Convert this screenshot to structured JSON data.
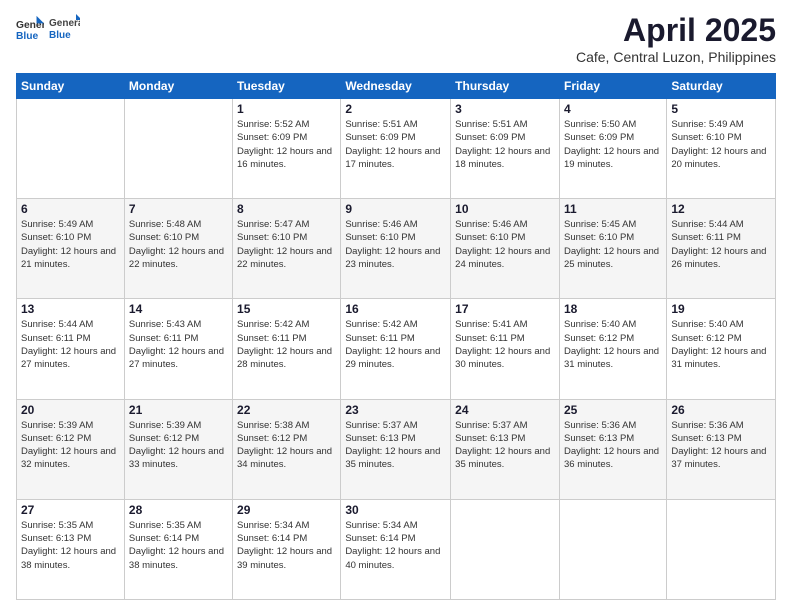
{
  "logo": {
    "general": "General",
    "blue": "Blue"
  },
  "header": {
    "month": "April 2025",
    "location": "Cafe, Central Luzon, Philippines"
  },
  "weekdays": [
    "Sunday",
    "Monday",
    "Tuesday",
    "Wednesday",
    "Thursday",
    "Friday",
    "Saturday"
  ],
  "weeks": [
    [
      {
        "day": null
      },
      {
        "day": null
      },
      {
        "day": "1",
        "sunrise": "Sunrise: 5:52 AM",
        "sunset": "Sunset: 6:09 PM",
        "daylight": "Daylight: 12 hours and 16 minutes."
      },
      {
        "day": "2",
        "sunrise": "Sunrise: 5:51 AM",
        "sunset": "Sunset: 6:09 PM",
        "daylight": "Daylight: 12 hours and 17 minutes."
      },
      {
        "day": "3",
        "sunrise": "Sunrise: 5:51 AM",
        "sunset": "Sunset: 6:09 PM",
        "daylight": "Daylight: 12 hours and 18 minutes."
      },
      {
        "day": "4",
        "sunrise": "Sunrise: 5:50 AM",
        "sunset": "Sunset: 6:09 PM",
        "daylight": "Daylight: 12 hours and 19 minutes."
      },
      {
        "day": "5",
        "sunrise": "Sunrise: 5:49 AM",
        "sunset": "Sunset: 6:10 PM",
        "daylight": "Daylight: 12 hours and 20 minutes."
      }
    ],
    [
      {
        "day": "6",
        "sunrise": "Sunrise: 5:49 AM",
        "sunset": "Sunset: 6:10 PM",
        "daylight": "Daylight: 12 hours and 21 minutes."
      },
      {
        "day": "7",
        "sunrise": "Sunrise: 5:48 AM",
        "sunset": "Sunset: 6:10 PM",
        "daylight": "Daylight: 12 hours and 22 minutes."
      },
      {
        "day": "8",
        "sunrise": "Sunrise: 5:47 AM",
        "sunset": "Sunset: 6:10 PM",
        "daylight": "Daylight: 12 hours and 22 minutes."
      },
      {
        "day": "9",
        "sunrise": "Sunrise: 5:46 AM",
        "sunset": "Sunset: 6:10 PM",
        "daylight": "Daylight: 12 hours and 23 minutes."
      },
      {
        "day": "10",
        "sunrise": "Sunrise: 5:46 AM",
        "sunset": "Sunset: 6:10 PM",
        "daylight": "Daylight: 12 hours and 24 minutes."
      },
      {
        "day": "11",
        "sunrise": "Sunrise: 5:45 AM",
        "sunset": "Sunset: 6:10 PM",
        "daylight": "Daylight: 12 hours and 25 minutes."
      },
      {
        "day": "12",
        "sunrise": "Sunrise: 5:44 AM",
        "sunset": "Sunset: 6:11 PM",
        "daylight": "Daylight: 12 hours and 26 minutes."
      }
    ],
    [
      {
        "day": "13",
        "sunrise": "Sunrise: 5:44 AM",
        "sunset": "Sunset: 6:11 PM",
        "daylight": "Daylight: 12 hours and 27 minutes."
      },
      {
        "day": "14",
        "sunrise": "Sunrise: 5:43 AM",
        "sunset": "Sunset: 6:11 PM",
        "daylight": "Daylight: 12 hours and 27 minutes."
      },
      {
        "day": "15",
        "sunrise": "Sunrise: 5:42 AM",
        "sunset": "Sunset: 6:11 PM",
        "daylight": "Daylight: 12 hours and 28 minutes."
      },
      {
        "day": "16",
        "sunrise": "Sunrise: 5:42 AM",
        "sunset": "Sunset: 6:11 PM",
        "daylight": "Daylight: 12 hours and 29 minutes."
      },
      {
        "day": "17",
        "sunrise": "Sunrise: 5:41 AM",
        "sunset": "Sunset: 6:11 PM",
        "daylight": "Daylight: 12 hours and 30 minutes."
      },
      {
        "day": "18",
        "sunrise": "Sunrise: 5:40 AM",
        "sunset": "Sunset: 6:12 PM",
        "daylight": "Daylight: 12 hours and 31 minutes."
      },
      {
        "day": "19",
        "sunrise": "Sunrise: 5:40 AM",
        "sunset": "Sunset: 6:12 PM",
        "daylight": "Daylight: 12 hours and 31 minutes."
      }
    ],
    [
      {
        "day": "20",
        "sunrise": "Sunrise: 5:39 AM",
        "sunset": "Sunset: 6:12 PM",
        "daylight": "Daylight: 12 hours and 32 minutes."
      },
      {
        "day": "21",
        "sunrise": "Sunrise: 5:39 AM",
        "sunset": "Sunset: 6:12 PM",
        "daylight": "Daylight: 12 hours and 33 minutes."
      },
      {
        "day": "22",
        "sunrise": "Sunrise: 5:38 AM",
        "sunset": "Sunset: 6:12 PM",
        "daylight": "Daylight: 12 hours and 34 minutes."
      },
      {
        "day": "23",
        "sunrise": "Sunrise: 5:37 AM",
        "sunset": "Sunset: 6:13 PM",
        "daylight": "Daylight: 12 hours and 35 minutes."
      },
      {
        "day": "24",
        "sunrise": "Sunrise: 5:37 AM",
        "sunset": "Sunset: 6:13 PM",
        "daylight": "Daylight: 12 hours and 35 minutes."
      },
      {
        "day": "25",
        "sunrise": "Sunrise: 5:36 AM",
        "sunset": "Sunset: 6:13 PM",
        "daylight": "Daylight: 12 hours and 36 minutes."
      },
      {
        "day": "26",
        "sunrise": "Sunrise: 5:36 AM",
        "sunset": "Sunset: 6:13 PM",
        "daylight": "Daylight: 12 hours and 37 minutes."
      }
    ],
    [
      {
        "day": "27",
        "sunrise": "Sunrise: 5:35 AM",
        "sunset": "Sunset: 6:13 PM",
        "daylight": "Daylight: 12 hours and 38 minutes."
      },
      {
        "day": "28",
        "sunrise": "Sunrise: 5:35 AM",
        "sunset": "Sunset: 6:14 PM",
        "daylight": "Daylight: 12 hours and 38 minutes."
      },
      {
        "day": "29",
        "sunrise": "Sunrise: 5:34 AM",
        "sunset": "Sunset: 6:14 PM",
        "daylight": "Daylight: 12 hours and 39 minutes."
      },
      {
        "day": "30",
        "sunrise": "Sunrise: 5:34 AM",
        "sunset": "Sunset: 6:14 PM",
        "daylight": "Daylight: 12 hours and 40 minutes."
      },
      {
        "day": null
      },
      {
        "day": null
      },
      {
        "day": null
      }
    ]
  ]
}
